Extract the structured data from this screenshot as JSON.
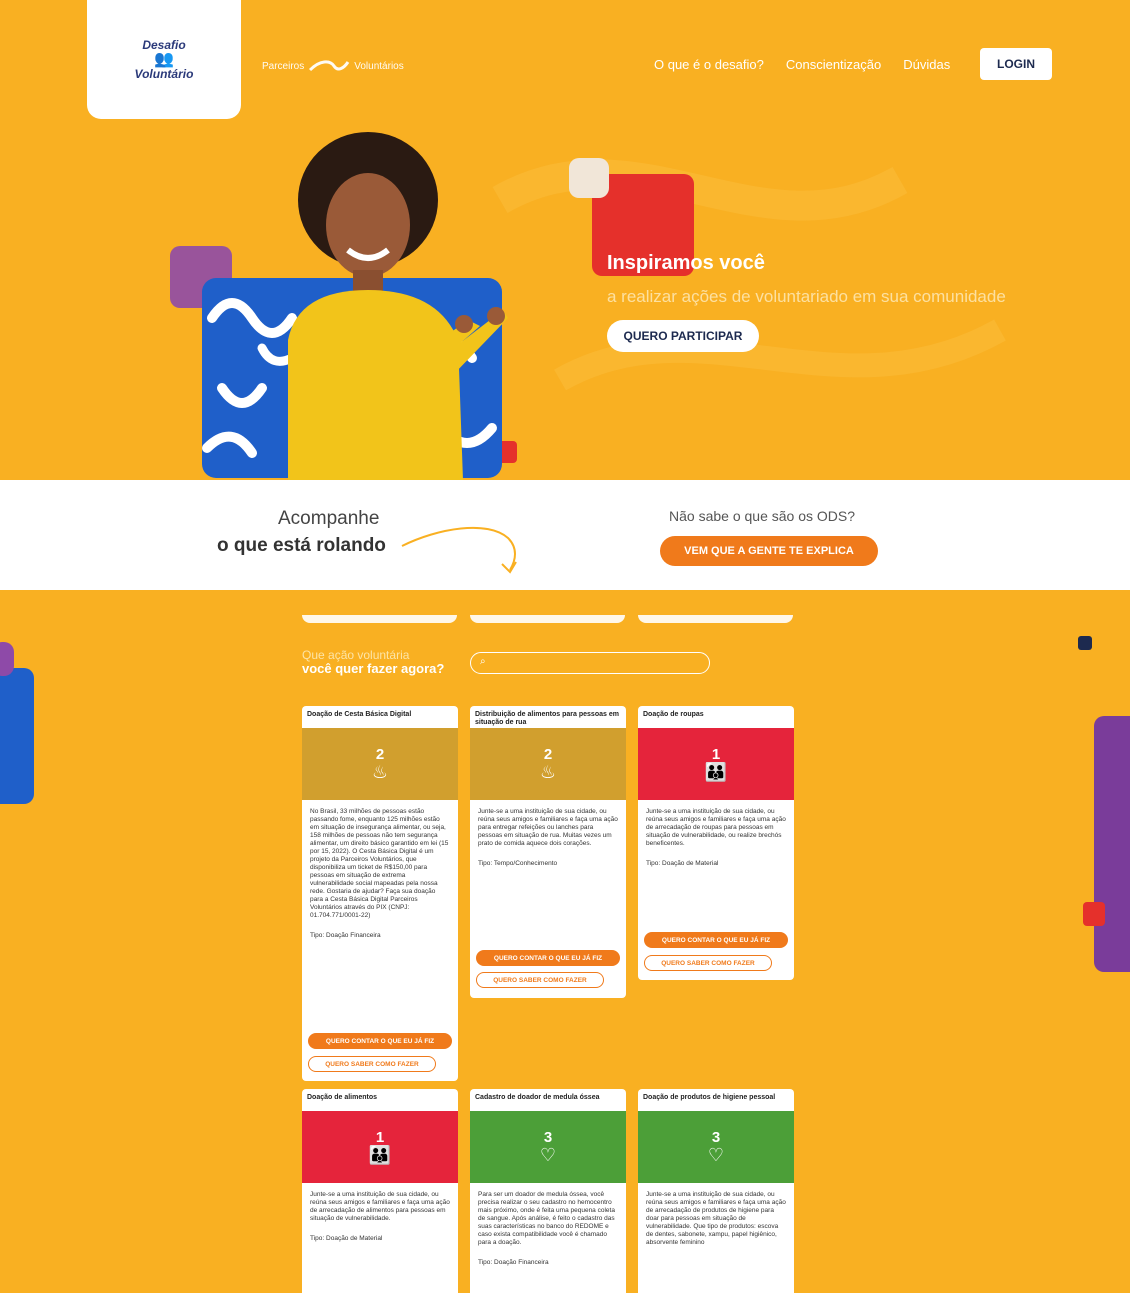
{
  "header": {
    "logo_line1": "Desafio",
    "logo_line2": "Voluntário",
    "partner_left": "Parceiros",
    "partner_right": "Voluntários",
    "nav": [
      "O que é o desafio?",
      "Conscientização",
      "Dúvidas"
    ],
    "login_label": "LOGIN"
  },
  "hero": {
    "title": "Inspiramos você",
    "subtitle": "a realizar ações de voluntariado em sua comunidade",
    "cta_label": "QUERO PARTICIPAR"
  },
  "follow": {
    "line1": "Acompanhe",
    "line2": "o que está rolando",
    "ods_question": "Não sabe o que são os ODS?",
    "ods_button": "VEM QUE A GENTE TE EXPLICA"
  },
  "actions": {
    "prompt_line1": "Que ação voluntária",
    "prompt_line2": "você quer fazer agora?",
    "search_placeholder": "",
    "btn_told": "QUERO CONTAR O QUE EU JÁ FIZ",
    "btn_learn": "QUERO SABER COMO FAZER",
    "cards": [
      {
        "title": "Doação de Cesta Básica Digital",
        "ods_number": "2",
        "ods_color": "#d19f2e",
        "ods_icon": "bowl-icon",
        "description": "No Brasil, 33 milhões de pessoas estão passando fome, enquanto 125 milhões estão em situação de insegurança alimentar, ou seja, 158 milhões de pessoas não tem segurança alimentar, um direito básico garantido em lei (15 por 15, 2022). O Cesta Básica Digital é um projeto da Parceiros Voluntários, que disponibiliza um ticket de R$150,00 para pessoas em situação de extrema vulnerabilidade social mapeadas pela nossa rede. Gostaria de ajudar? Faça sua doação para a Cesta Básica Digital Parceiros Voluntários através do PIX (CNPJ: 01.704.771/0001-22)",
        "tipo": "Tipo: Doação Financeira"
      },
      {
        "title": "Distribuição de alimentos para pessoas em situação de rua",
        "ods_number": "2",
        "ods_color": "#d19f2e",
        "ods_icon": "bowl-icon",
        "description": "Junte-se a uma instituição de sua cidade, ou reúna seus amigos e familiares e faça uma ação para entregar refeições ou lanches para pessoas em situação de rua. Muitas vezes um prato de comida aquece dois corações.",
        "tipo": "Tipo: Tempo/Conhecimento"
      },
      {
        "title": "Doação de roupas",
        "ods_number": "1",
        "ods_color": "#e5243b",
        "ods_icon": "family-icon",
        "description": "Junte-se a uma instituição de sua cidade, ou reúna seus amigos e familiares e faça uma ação de arrecadação de roupas para pessoas em situação de vulnerabilidade, ou realize brechós beneficentes.",
        "tipo": "Tipo: Doação de Material"
      },
      {
        "title": "Doação de alimentos",
        "ods_number": "1",
        "ods_color": "#e5243b",
        "ods_icon": "family-icon",
        "description": "Junte-se a uma instituição de sua cidade, ou reúna seus amigos e familiares e faça uma ação de arrecadação de alimentos para pessoas em situação de vulnerabilidade.",
        "tipo": "Tipo: Doação de Material"
      },
      {
        "title": "Cadastro de doador de medula óssea",
        "ods_number": "3",
        "ods_color": "#4c9f38",
        "ods_icon": "heartbeat-icon",
        "description": "Para ser um doador de medula óssea, você precisa realizar o seu cadastro no hemocentro mais próximo, onde é feita uma pequena coleta de sangue. Após análise, é feito o cadastro das suas características no banco do REDOME e caso exista compatibilidade você é chamado para a doação.",
        "tipo": "Tipo: Doação Financeira"
      },
      {
        "title": "Doação de produtos de higiene pessoal",
        "ods_number": "3",
        "ods_color": "#4c9f38",
        "ods_icon": "heartbeat-icon",
        "description": "Junte-se a uma instituição de sua cidade, ou reúna seus amigos e familiares e faça uma ação de arrecadação de produtos de higiene para doar para pessoas em situação de vulnerabilidade. Que tipo de produtos: escova de dentes, sabonete, xampu, papel higiênico, absorvente feminino",
        "tipo": ""
      }
    ]
  }
}
